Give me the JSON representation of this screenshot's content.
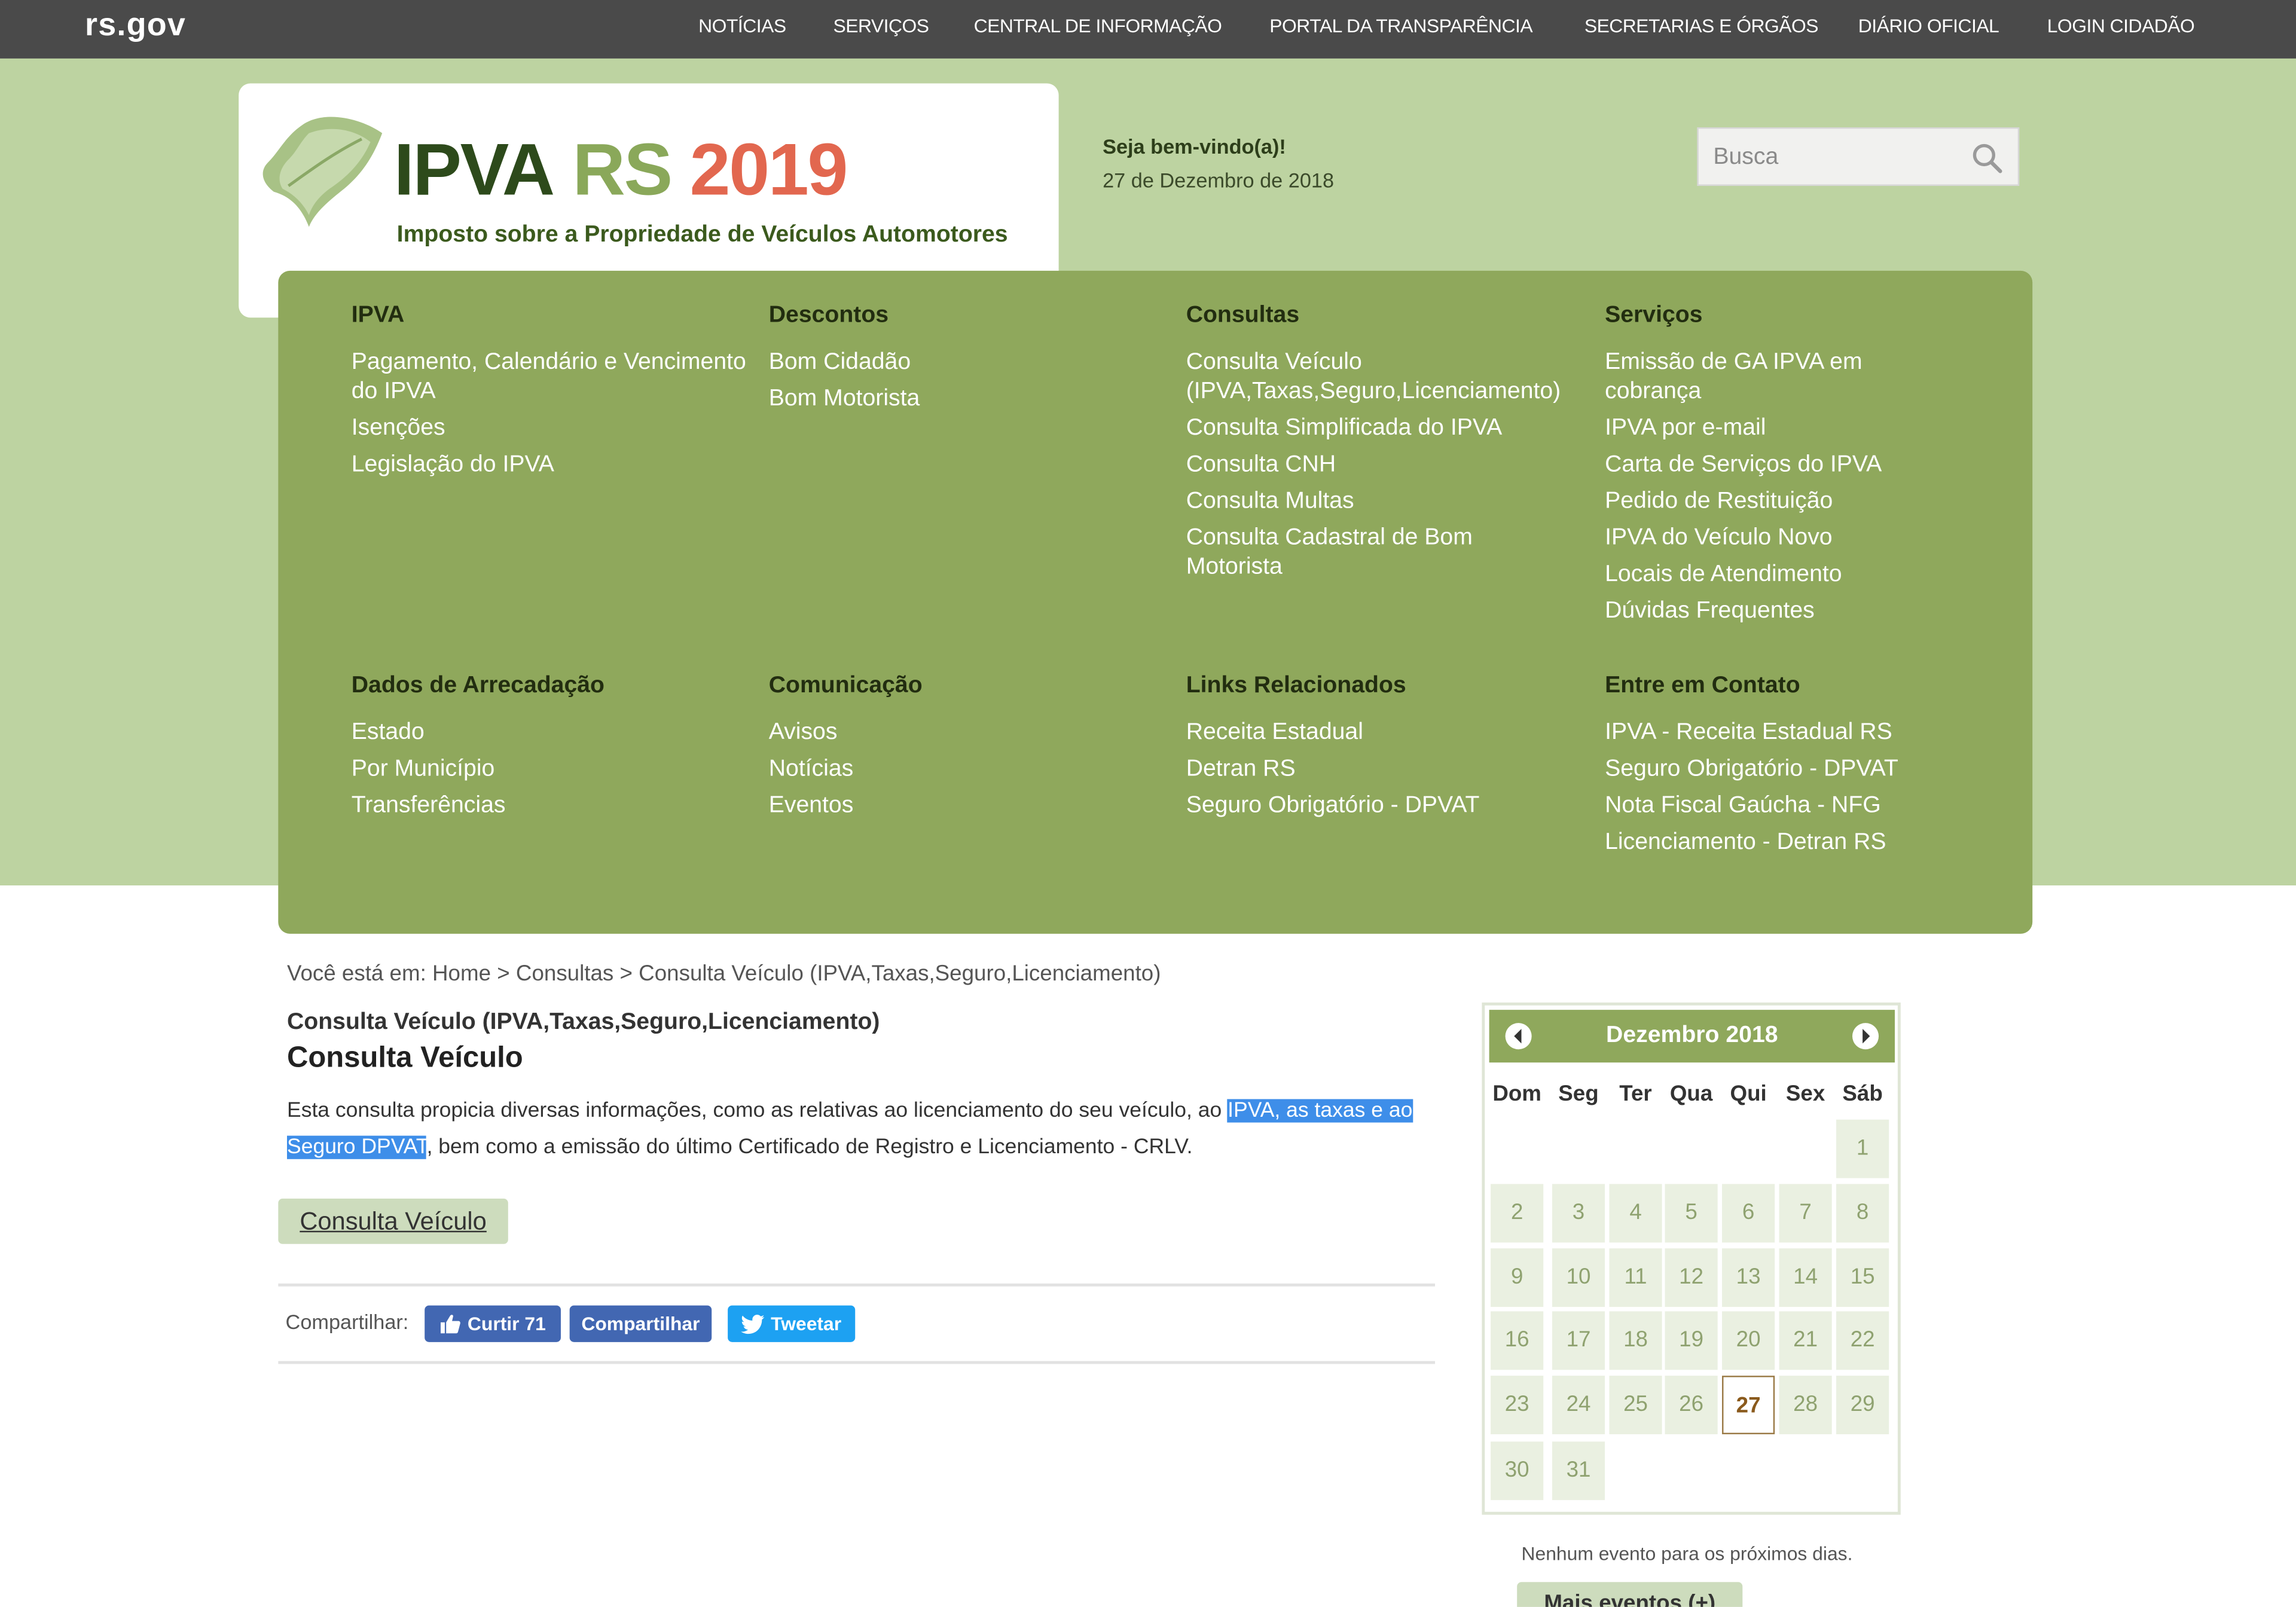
{
  "topbar": {
    "brand": "rs.gov",
    "nav": [
      "NOTÍCIAS",
      "SERVIÇOS",
      "CENTRAL DE INFORMAÇÃO",
      "PORTAL DA TRANSPARÊNCIA",
      "SECRETARIAS E ÓRGÃOS",
      "DIÁRIO OFICIAL",
      "LOGIN CIDADÃO"
    ]
  },
  "header": {
    "logo_ipva": "IPVA",
    "logo_rs": "RS",
    "logo_year": "2019",
    "logo_subtitle": "Imposto sobre a Propriedade de Veículos Automotores",
    "welcome": "Seja bem-vindo(a)!",
    "date": "27 de Dezembro de 2018",
    "search_placeholder": "Busca"
  },
  "menu": [
    {
      "title": "IPVA",
      "links": [
        "Pagamento, Calendário e Vencimento do IPVA",
        "Isenções",
        "Legislação do IPVA"
      ]
    },
    {
      "title": "Descontos",
      "links": [
        "Bom Cidadão",
        "Bom Motorista"
      ]
    },
    {
      "title": "Consultas",
      "links": [
        "Consulta Veículo (IPVA,Taxas,Seguro,Licenciamento)",
        "Consulta Simplificada do IPVA",
        "Consulta CNH",
        "Consulta Multas",
        "Consulta Cadastral de Bom Motorista"
      ]
    },
    {
      "title": "Serviços",
      "links": [
        "Emissão de GA IPVA em cobrança",
        "IPVA por e-mail",
        "Carta de Serviços do IPVA",
        "Pedido de Restituição",
        "IPVA do Veículo Novo",
        "Locais de Atendimento",
        "Dúvidas Frequentes"
      ]
    },
    {
      "title": "Dados de Arrecadação",
      "links": [
        "Estado",
        "Por Município",
        "Transferências"
      ]
    },
    {
      "title": "Comunicação",
      "links": [
        "Avisos",
        "Notícias",
        "Eventos"
      ]
    },
    {
      "title": "Links Relacionados",
      "links": [
        "Receita Estadual",
        "Detran RS",
        "Seguro Obrigatório - DPVAT"
      ]
    },
    {
      "title": "Entre em Contato",
      "links": [
        "IPVA - Receita Estadual RS",
        "Seguro Obrigatório - DPVAT",
        "Nota Fiscal Gaúcha - NFG",
        "Licenciamento - Detran RS"
      ]
    }
  ],
  "breadcrumb": {
    "prefix": "Você está em:",
    "home": "Home",
    "sep": ">",
    "level2": "Consultas",
    "current": "Consulta Veículo (IPVA,Taxas,Seguro,Licenciamento)"
  },
  "content": {
    "small_title": "Consulta Veículo (IPVA,Taxas,Seguro,Licenciamento)",
    "title": "Consulta Veículo",
    "desc_before": "Esta consulta propicia diversas informações, como as relativas ao licenciamento do seu veículo, ao ",
    "desc_highlight": "IPVA, as taxas e ao Seguro DPVAT",
    "desc_after": ", bem como a emissão do último Certificado de Registro e Licenciamento - CRLV.",
    "button": "Consulta Veículo"
  },
  "share": {
    "label": "Compartilhar:",
    "like": "Curtir 71",
    "share": "Compartilhar",
    "tweet": "Tweetar"
  },
  "calendar": {
    "month": "Dezembro 2018",
    "weekdays": [
      "Dom",
      "Seg",
      "Ter",
      "Qua",
      "Qui",
      "Sex",
      "Sáb"
    ],
    "first_weekday": 6,
    "days_in_month": 31,
    "today": 27,
    "no_events": "Nenhum evento para os próximos dias.",
    "more_events": "Mais eventos (+)"
  },
  "colors": {
    "topbar": "#4a4a4a",
    "band": "#bdd3a1",
    "menu": "#8fa85c",
    "highlight": "#3e8ee9",
    "facebook": "#4267b2",
    "twitter": "#1da1f2"
  }
}
